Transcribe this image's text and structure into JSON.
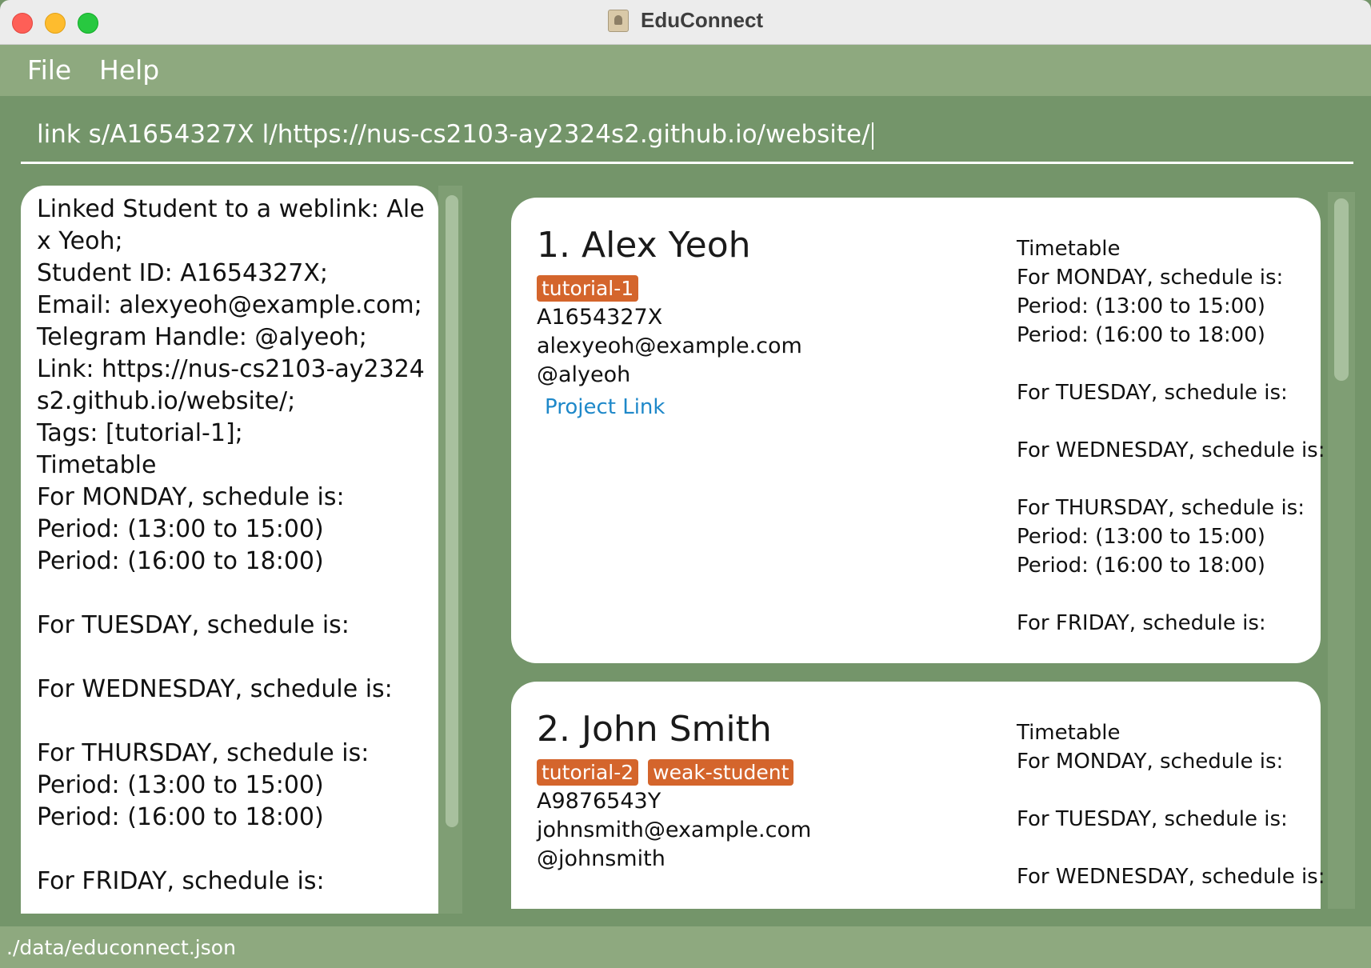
{
  "window": {
    "title": "EduConnect"
  },
  "menu": {
    "file": "File",
    "help": "Help"
  },
  "command": {
    "value": "link s/A1654327X l/https://nus-cs2103-ay2324s2.github.io/website/"
  },
  "result": {
    "text": "Linked Student to a weblink: Alex Yeoh;\nStudent ID: A1654327X;\nEmail: alexyeoh@example.com;\nTelegram Handle: @alyeoh;\nLink: https://nus-cs2103-ay2324s2.github.io/website/;\nTags: [tutorial-1];\nTimetable\nFor MONDAY, schedule is:\nPeriod: (13:00 to 15:00)\nPeriod: (16:00 to 18:00)\n\nFor TUESDAY, schedule is:\n\nFor WEDNESDAY, schedule is:\n\nFor THURSDAY, schedule is:\nPeriod: (13:00 to 15:00)\nPeriod: (16:00 to 18:00)\n\nFor FRIDAY, schedule is:"
  },
  "students": [
    {
      "name": "1.  Alex Yeoh",
      "tags": [
        "tutorial-1"
      ],
      "id": "A1654327X",
      "email": "alexyeoh@example.com",
      "telegram": "@alyeoh",
      "link_label": "Project Link",
      "timetable": "Timetable\nFor MONDAY, schedule is:\nPeriod: (13:00 to 15:00)\nPeriod: (16:00 to 18:00)\n\nFor TUESDAY, schedule is:\n\nFor WEDNESDAY, schedule is:\n\nFor THURSDAY, schedule is:\nPeriod: (13:00 to 15:00)\nPeriod: (16:00 to 18:00)\n\nFor FRIDAY, schedule is:"
    },
    {
      "name": "2.  John Smith",
      "tags": [
        "tutorial-2",
        "weak-student"
      ],
      "id": "A9876543Y",
      "email": "johnsmith@example.com",
      "telegram": "@johnsmith",
      "timetable": "Timetable\nFor MONDAY, schedule is:\n\nFor TUESDAY, schedule is:\n\nFor WEDNESDAY, schedule is:"
    }
  ],
  "status": {
    "file_path": "./data/educonnect.json"
  },
  "colors": {
    "tag": "#d4652c",
    "link": "#1e88c9",
    "window_bg": "#74956a",
    "menu_bg": "#8ea97f"
  },
  "icons": {
    "app": "app-icon"
  }
}
